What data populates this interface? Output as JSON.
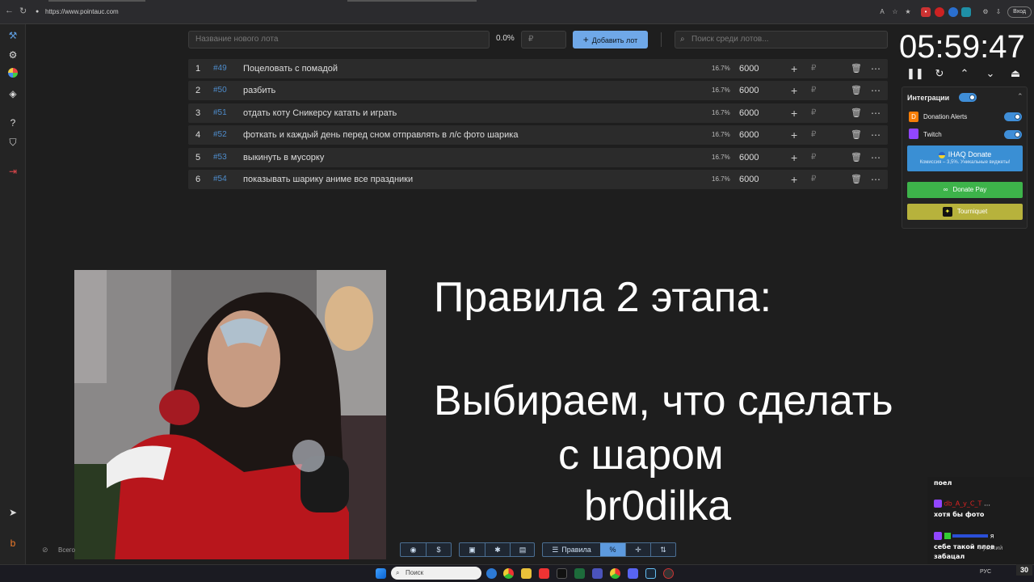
{
  "browser": {
    "url": "https://www.pointauc.com",
    "profile_label": "Вход"
  },
  "topbar": {
    "new_lot_placeholder": "Название нового лота",
    "percent": "0.0%",
    "currency_placeholder": "₽",
    "add_button": "Добавить лот",
    "search_placeholder": "Поиск среди лотов..."
  },
  "lots": [
    {
      "num": "1",
      "id": "#49",
      "name": "Поцеловать с помадой",
      "pct": "16.7%",
      "amount": "6000"
    },
    {
      "num": "2",
      "id": "#50",
      "name": "разбить",
      "pct": "16.7%",
      "amount": "6000"
    },
    {
      "num": "3",
      "id": "#51",
      "name": "отдать коту Сникерсу катать и играть",
      "pct": "16.7%",
      "amount": "6000"
    },
    {
      "num": "4",
      "id": "#52",
      "name": "фоткать и каждый день перед сном отправлять в л/с фото шарика",
      "pct": "16.7%",
      "amount": "6000"
    },
    {
      "num": "5",
      "id": "#53",
      "name": "выкинуть в мусорку",
      "pct": "16.7%",
      "amount": "6000"
    },
    {
      "num": "6",
      "id": "#54",
      "name": "показывать шарику аниме все праздники",
      "pct": "16.7%",
      "amount": "6000"
    }
  ],
  "lot_currency": "₽",
  "timer": "05:59:47",
  "integrations": {
    "title": "Интеграции",
    "donation_alerts": "Donation Alerts",
    "twitch": "Twitch",
    "ihaq_title": "IHAQ Donate",
    "ihaq_sub": "Комиссия – 3,5%. Уникальные виджеты!",
    "donate_pay": "Donate Pay",
    "tourniquet": "Tourniquet"
  },
  "overlay": {
    "line1": "Правила 2 этапа:",
    "line2": "Выбираем, что сделать",
    "line3": "с  шаром",
    "line4": "br0dilka"
  },
  "toolbar": {
    "rules": "Правила",
    "all_label": "Всего"
  },
  "chat": {
    "msg1": "поел",
    "msg2_user": "db_A_y_C_T",
    "msg2_text": "хотя бы фото",
    "msg3_text_a": "я",
    "msg3_text_b": "себе такой плов",
    "msg3_text_c": "забацал",
    "lang": "Русский",
    "count": "30"
  },
  "taskbar": {
    "search_placeholder": "Поиск",
    "lang": "РУС"
  },
  "colors": {
    "accent": "#6fa8e8",
    "ihaq": "#3a8fd4",
    "donate_pay": "#3db34a",
    "tourniquet": "#b7b23c",
    "twitch": "#9146ff",
    "donation_alerts": "#f57d07"
  }
}
